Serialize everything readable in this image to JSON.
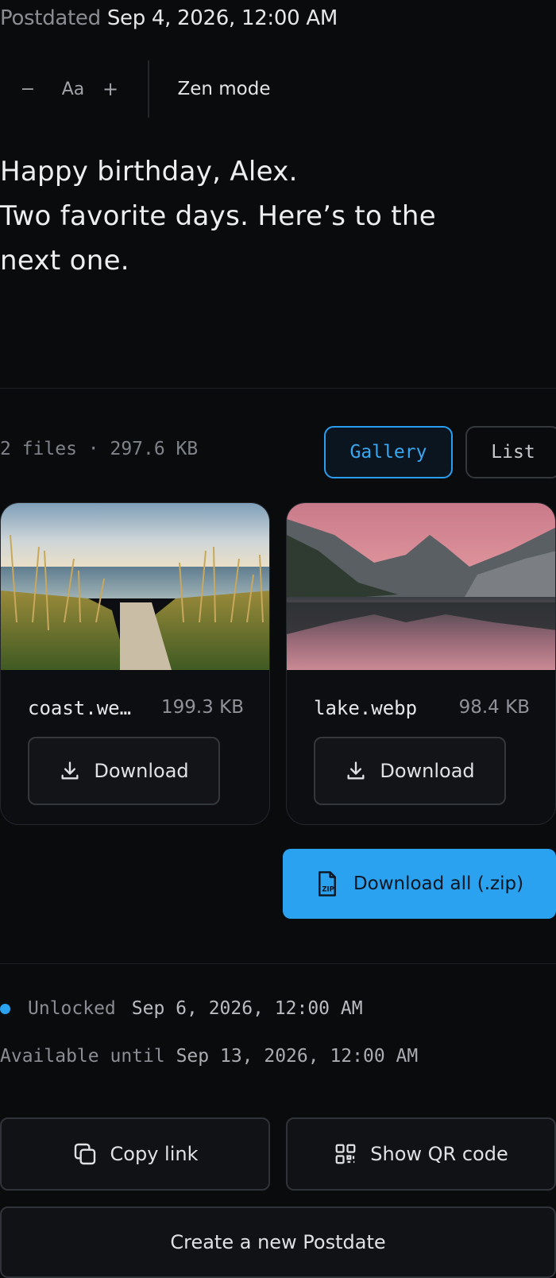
{
  "header": {
    "postdated_label": "Postdated",
    "postdated_value": "Sep 4, 2026, 12:00 AM"
  },
  "toolbar": {
    "decrease": "−",
    "font": "Aa",
    "increase": "+",
    "zen": "Zen mode"
  },
  "message": {
    "lines": [
      "Happy birthday, Alex.",
      "Two favorite days. Here’s to the",
      "next one."
    ]
  },
  "files": {
    "summary": "2 files · 297.6 KB",
    "view_options": {
      "gallery": "Gallery",
      "list": "List",
      "selected": "Gallery"
    },
    "items": [
      {
        "name": "coast.we…",
        "size": "199.3 KB",
        "download": "Download",
        "thumb": "beach-dunes-photo"
      },
      {
        "name": "lake.webp",
        "size": "98.4 KB",
        "download": "Download",
        "thumb": "mountain-lake-photo"
      }
    ],
    "download_all": "Download all (.zip)"
  },
  "status": {
    "unlocked_label": "Unlocked",
    "unlocked_date": "Sep 6, 2026, 12:00 AM",
    "available_label": "Available until",
    "available_date": "Sep 13, 2026, 12:00 AM",
    "indicator_color": "#2aa2f0"
  },
  "actions": {
    "copy_link": "Copy link",
    "show_qr": "Show QR code",
    "create_new": "Create a new Postdate"
  },
  "colors": {
    "background": "#0a0b0d",
    "accent": "#2aa2f0"
  }
}
